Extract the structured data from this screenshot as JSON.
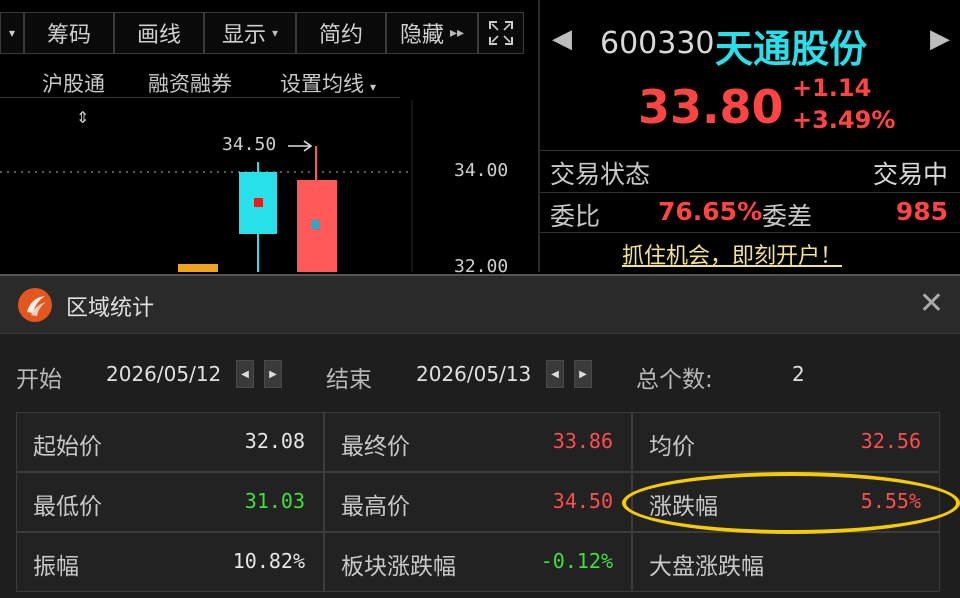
{
  "toolbar": {
    "items": [
      "筹码",
      "画线",
      "显示",
      "简约",
      "隐藏"
    ]
  },
  "subbar": {
    "items": [
      "沪股通",
      "融资融券",
      "设置均线"
    ]
  },
  "chart": {
    "high_annotation": "34.50",
    "price_ticks": [
      "34.00",
      "32.00"
    ]
  },
  "quote": {
    "code": "600330",
    "name": "天通股份",
    "price": "33.80",
    "change": "+1.14",
    "change_pct": "+3.49%",
    "status_label": "交易状态",
    "status_value": "交易中",
    "weibi_label": "委比",
    "weibi_value": "76.65%",
    "weicha_label": "委差",
    "weicha_value": "985",
    "promo": "抓住机会，即刻开户！",
    "colors": {
      "up": "#ff4444",
      "name": "#27e0ea"
    }
  },
  "dialog": {
    "title": "区域统计",
    "start_label": "开始",
    "start_date": "2026/05/12",
    "end_label": "结束",
    "end_date": "2026/05/13",
    "count_label": "总个数:",
    "count_value": "2",
    "stats": [
      {
        "label": "起始价",
        "value": "32.08",
        "color": "white"
      },
      {
        "label": "最终价",
        "value": "33.86",
        "color": "red"
      },
      {
        "label": "均价",
        "value": "32.56",
        "color": "red"
      },
      {
        "label": "最低价",
        "value": "31.03",
        "color": "green"
      },
      {
        "label": "最高价",
        "value": "34.50",
        "color": "red"
      },
      {
        "label": "涨跌幅",
        "value": "5.55%",
        "color": "red"
      },
      {
        "label": "振幅",
        "value": "10.82%",
        "color": "white"
      },
      {
        "label": "板块涨跌幅",
        "value": "-0.12%",
        "color": "green"
      },
      {
        "label": "大盘涨跌幅",
        "value": "",
        "color": "green"
      }
    ]
  }
}
